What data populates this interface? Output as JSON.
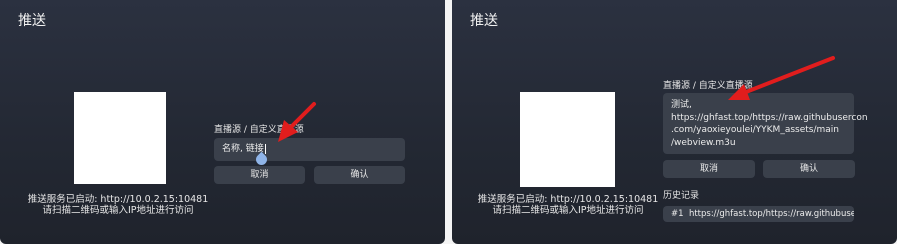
{
  "left": {
    "title": "推送",
    "server_status": "推送服务已启动: http://10.0.2.15:10481",
    "scan_hint": "请扫描二维码或输入IP地址进行访问",
    "source_label": "直播源 / 自定义直播源",
    "input_value": "名称, 链接",
    "cancel_label": "取消",
    "confirm_label": "确认"
  },
  "right": {
    "title": "推送",
    "server_status": "推送服务已启动: http://10.0.2.15:10481",
    "scan_hint": "请扫描二维码或输入IP地址进行访问",
    "source_label": "直播源 / 自定义直播源",
    "input_value": "测试,\nhttps://ghfast.top/https://raw.githubusercon\n.com/yaoxieyoulei/YYKM_assets/main\n/webview.m3u",
    "cancel_label": "取消",
    "confirm_label": "确认",
    "history_title": "历史记录",
    "history": [
      {
        "index": "#1",
        "url": "https://ghfast.top/https://raw.githubuserconte..."
      }
    ]
  },
  "colors": {
    "arrow": "#e11d1d",
    "panel": "#262b36"
  }
}
